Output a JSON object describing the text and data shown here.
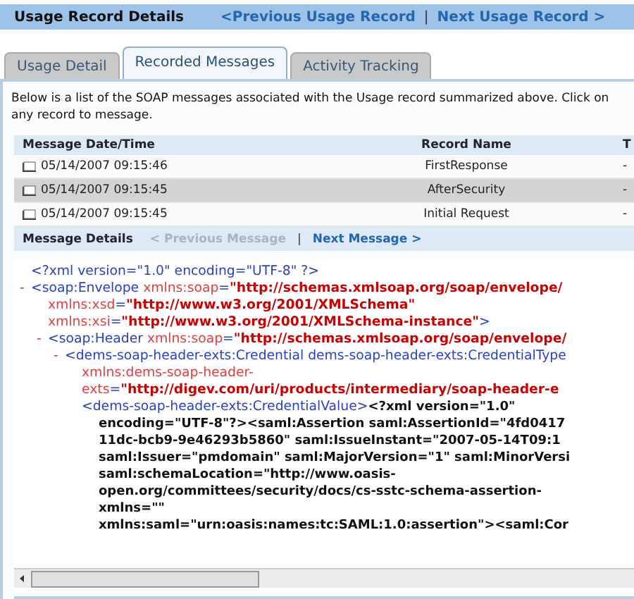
{
  "header": {
    "title": "Usage Record Details",
    "links": [
      {
        "label": "<Previous Usage Record",
        "kind": "link"
      },
      {
        "label": "|",
        "kind": "separator"
      },
      {
        "label": "Next Usage Record >",
        "kind": "link"
      }
    ]
  },
  "tabs": [
    {
      "label": "Usage Detail",
      "selected": false
    },
    {
      "label": "Recorded Messages",
      "selected": true
    },
    {
      "label": "Activity Tracking",
      "selected": false
    }
  ],
  "intro": "Below is a list of the SOAP messages associated with the Usage record summarized above. Click on any record to message.",
  "table": {
    "columns": [
      "Message Date/Time",
      "Record Name",
      "T"
    ],
    "rows": [
      {
        "date": "05/14/2007 09:15:46",
        "name": "FirstResponse",
        "column_3": "-",
        "selected": false
      },
      {
        "date": "05/14/2007 09:15:45",
        "name": "AfterSecurity",
        "column_3": "-",
        "selected": true
      },
      {
        "date": "05/14/2007 09:15:45",
        "name": "Initial Request",
        "column_3": "-",
        "selected": false
      }
    ]
  },
  "details_bar": {
    "title": "Message Details",
    "previous": {
      "label": "< Previous Message",
      "disabled": true
    },
    "separator": "|",
    "next": {
      "label": "Next Message >",
      "disabled": false
    }
  },
  "xml": [
    {
      "lines": [
        [
          {
            "kind": "tag",
            "text": "<?xml version=\"1.0\" encoding=\"UTF-8\" ?>"
          }
        ]
      ]
    },
    {
      "toggle": "-",
      "lines": [
        [
          {
            "kind": "tag",
            "text": "<soap:Envelope "
          },
          {
            "kind": "attr",
            "text": "xmlns:soap"
          },
          {
            "kind": "tag",
            "text": "="
          },
          {
            "kind": "value",
            "text": "\"http://schemas.xmlsoap.org/soap/envelope/"
          }
        ],
        [
          {
            "kind": "attr",
            "text": "xmlns:xsd"
          },
          {
            "kind": "tag",
            "text": "="
          },
          {
            "kind": "value",
            "text": "\"http://www.w3.org/2001/XMLSchema\""
          }
        ],
        [
          {
            "kind": "attr",
            "text": "xmlns:xsi"
          },
          {
            "kind": "tag",
            "text": "="
          },
          {
            "kind": "value",
            "text": "\"http://www.w3.org/2001/XMLSchema-instance\""
          },
          {
            "kind": "tag",
            "text": ">"
          }
        ]
      ],
      "children": [
        {
          "toggle": "-",
          "lines": [
            [
              {
                "kind": "tag",
                "text": "<soap:Header "
              },
              {
                "kind": "attr",
                "text": "xmlns:soap"
              },
              {
                "kind": "tag",
                "text": "="
              },
              {
                "kind": "value",
                "text": "\"http://schemas.xmlsoap.org/soap/envelope/"
              }
            ]
          ],
          "children": [
            {
              "toggle": "-",
              "lines": [
                [
                  {
                    "kind": "tag",
                    "text": "<dems-soap-header-exts:Credential dems-soap-header-exts:CredentialType"
                  }
                ],
                [
                  {
                    "kind": "attr",
                    "text": "xmlns:dems-soap-header-"
                  }
                ],
                [
                  {
                    "kind": "attr",
                    "text": "exts"
                  },
                  {
                    "kind": "tag",
                    "text": "="
                  },
                  {
                    "kind": "value",
                    "text": "\"http://digev.com/uri/products/intermediary/soap-header-e"
                  }
                ]
              ],
              "children": [
                {
                  "lines": [
                    [
                      {
                        "kind": "tag",
                        "text": "<dems-soap-header-exts:CredentialValue>"
                      },
                      {
                        "kind": "text",
                        "text": "<?xml version=\"1.0\""
                      }
                    ],
                    [
                      {
                        "kind": "text",
                        "text": "encoding=\"UTF-8\"?><saml:Assertion saml:AssertionId=\"4fd0417"
                      }
                    ],
                    [
                      {
                        "kind": "text",
                        "text": "11dc-bcb9-9e46293b5860\" saml:IssueInstant=\"2007-05-14T09:1"
                      }
                    ],
                    [
                      {
                        "kind": "text",
                        "text": "saml:Issuer=\"pmdomain\" saml:MajorVersion=\"1\" saml:MinorVersi"
                      }
                    ],
                    [
                      {
                        "kind": "text",
                        "text": "saml:schemaLocation=\"http://www.oasis-"
                      }
                    ],
                    [
                      {
                        "kind": "text",
                        "text": "open.org/committees/security/docs/cs-sstc-schema-assertion-"
                      }
                    ],
                    [
                      {
                        "kind": "text",
                        "text": "xmlns=\"\""
                      }
                    ],
                    [
                      {
                        "kind": "text",
                        "text": "xmlns:saml=\"urn:oasis:names:tc:SAML:1.0:assertion\"><saml:Cor"
                      }
                    ]
                  ]
                }
              ]
            }
          ]
        }
      ]
    }
  ]
}
